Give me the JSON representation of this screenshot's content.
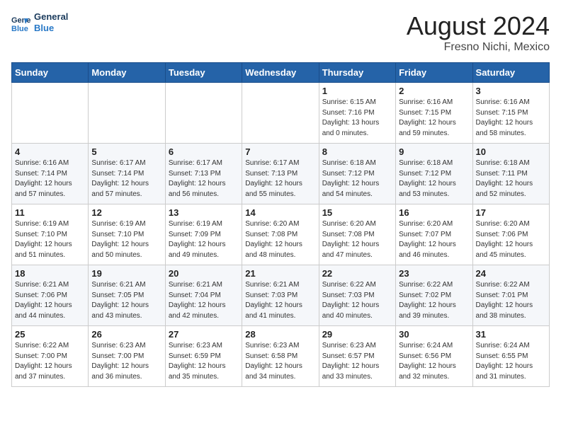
{
  "header": {
    "logo_line1": "General",
    "logo_line2": "Blue",
    "month_title": "August 2024",
    "location": "Fresno Nichi, Mexico"
  },
  "days_of_week": [
    "Sunday",
    "Monday",
    "Tuesday",
    "Wednesday",
    "Thursday",
    "Friday",
    "Saturday"
  ],
  "weeks": [
    [
      {
        "day": "",
        "info": ""
      },
      {
        "day": "",
        "info": ""
      },
      {
        "day": "",
        "info": ""
      },
      {
        "day": "",
        "info": ""
      },
      {
        "day": "1",
        "info": "Sunrise: 6:15 AM\nSunset: 7:16 PM\nDaylight: 13 hours\nand 0 minutes."
      },
      {
        "day": "2",
        "info": "Sunrise: 6:16 AM\nSunset: 7:15 PM\nDaylight: 12 hours\nand 59 minutes."
      },
      {
        "day": "3",
        "info": "Sunrise: 6:16 AM\nSunset: 7:15 PM\nDaylight: 12 hours\nand 58 minutes."
      }
    ],
    [
      {
        "day": "4",
        "info": "Sunrise: 6:16 AM\nSunset: 7:14 PM\nDaylight: 12 hours\nand 57 minutes."
      },
      {
        "day": "5",
        "info": "Sunrise: 6:17 AM\nSunset: 7:14 PM\nDaylight: 12 hours\nand 57 minutes."
      },
      {
        "day": "6",
        "info": "Sunrise: 6:17 AM\nSunset: 7:13 PM\nDaylight: 12 hours\nand 56 minutes."
      },
      {
        "day": "7",
        "info": "Sunrise: 6:17 AM\nSunset: 7:13 PM\nDaylight: 12 hours\nand 55 minutes."
      },
      {
        "day": "8",
        "info": "Sunrise: 6:18 AM\nSunset: 7:12 PM\nDaylight: 12 hours\nand 54 minutes."
      },
      {
        "day": "9",
        "info": "Sunrise: 6:18 AM\nSunset: 7:12 PM\nDaylight: 12 hours\nand 53 minutes."
      },
      {
        "day": "10",
        "info": "Sunrise: 6:18 AM\nSunset: 7:11 PM\nDaylight: 12 hours\nand 52 minutes."
      }
    ],
    [
      {
        "day": "11",
        "info": "Sunrise: 6:19 AM\nSunset: 7:10 PM\nDaylight: 12 hours\nand 51 minutes."
      },
      {
        "day": "12",
        "info": "Sunrise: 6:19 AM\nSunset: 7:10 PM\nDaylight: 12 hours\nand 50 minutes."
      },
      {
        "day": "13",
        "info": "Sunrise: 6:19 AM\nSunset: 7:09 PM\nDaylight: 12 hours\nand 49 minutes."
      },
      {
        "day": "14",
        "info": "Sunrise: 6:20 AM\nSunset: 7:08 PM\nDaylight: 12 hours\nand 48 minutes."
      },
      {
        "day": "15",
        "info": "Sunrise: 6:20 AM\nSunset: 7:08 PM\nDaylight: 12 hours\nand 47 minutes."
      },
      {
        "day": "16",
        "info": "Sunrise: 6:20 AM\nSunset: 7:07 PM\nDaylight: 12 hours\nand 46 minutes."
      },
      {
        "day": "17",
        "info": "Sunrise: 6:20 AM\nSunset: 7:06 PM\nDaylight: 12 hours\nand 45 minutes."
      }
    ],
    [
      {
        "day": "18",
        "info": "Sunrise: 6:21 AM\nSunset: 7:06 PM\nDaylight: 12 hours\nand 44 minutes."
      },
      {
        "day": "19",
        "info": "Sunrise: 6:21 AM\nSunset: 7:05 PM\nDaylight: 12 hours\nand 43 minutes."
      },
      {
        "day": "20",
        "info": "Sunrise: 6:21 AM\nSunset: 7:04 PM\nDaylight: 12 hours\nand 42 minutes."
      },
      {
        "day": "21",
        "info": "Sunrise: 6:21 AM\nSunset: 7:03 PM\nDaylight: 12 hours\nand 41 minutes."
      },
      {
        "day": "22",
        "info": "Sunrise: 6:22 AM\nSunset: 7:03 PM\nDaylight: 12 hours\nand 40 minutes."
      },
      {
        "day": "23",
        "info": "Sunrise: 6:22 AM\nSunset: 7:02 PM\nDaylight: 12 hours\nand 39 minutes."
      },
      {
        "day": "24",
        "info": "Sunrise: 6:22 AM\nSunset: 7:01 PM\nDaylight: 12 hours\nand 38 minutes."
      }
    ],
    [
      {
        "day": "25",
        "info": "Sunrise: 6:22 AM\nSunset: 7:00 PM\nDaylight: 12 hours\nand 37 minutes."
      },
      {
        "day": "26",
        "info": "Sunrise: 6:23 AM\nSunset: 7:00 PM\nDaylight: 12 hours\nand 36 minutes."
      },
      {
        "day": "27",
        "info": "Sunrise: 6:23 AM\nSunset: 6:59 PM\nDaylight: 12 hours\nand 35 minutes."
      },
      {
        "day": "28",
        "info": "Sunrise: 6:23 AM\nSunset: 6:58 PM\nDaylight: 12 hours\nand 34 minutes."
      },
      {
        "day": "29",
        "info": "Sunrise: 6:23 AM\nSunset: 6:57 PM\nDaylight: 12 hours\nand 33 minutes."
      },
      {
        "day": "30",
        "info": "Sunrise: 6:24 AM\nSunset: 6:56 PM\nDaylight: 12 hours\nand 32 minutes."
      },
      {
        "day": "31",
        "info": "Sunrise: 6:24 AM\nSunset: 6:55 PM\nDaylight: 12 hours\nand 31 minutes."
      }
    ]
  ]
}
